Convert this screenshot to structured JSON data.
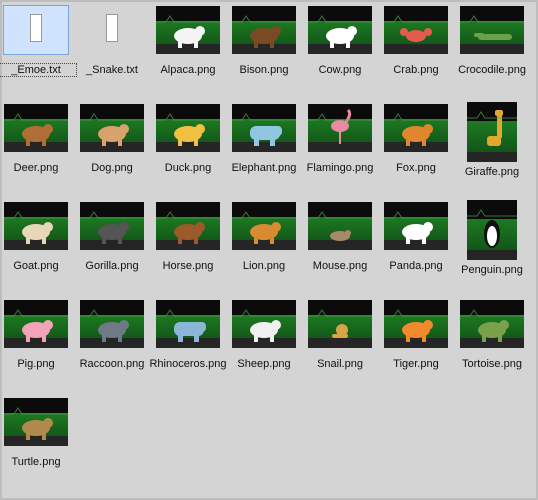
{
  "files": [
    {
      "name": "_Emoe.txt",
      "kind": "txt",
      "selected": true,
      "animal": "doc-icon"
    },
    {
      "name": "_Snake.txt",
      "kind": "txt",
      "selected": false,
      "animal": "doc-icon"
    },
    {
      "name": "Alpaca.png",
      "kind": "png",
      "animal": "alpaca",
      "color": "#f4f4f4"
    },
    {
      "name": "Bison.png",
      "kind": "png",
      "animal": "bison",
      "color": "#7a4a25"
    },
    {
      "name": "Cow.png",
      "kind": "png",
      "animal": "cow",
      "color": "#ffffff"
    },
    {
      "name": "Crab.png",
      "kind": "png",
      "animal": "crab",
      "color": "#e35b4e"
    },
    {
      "name": "Crocodile.png",
      "kind": "png",
      "animal": "crocodile",
      "color": "#6aa14a"
    },
    {
      "name": "Deer.png",
      "kind": "png",
      "animal": "deer",
      "color": "#b06f37"
    },
    {
      "name": "Dog.png",
      "kind": "png",
      "animal": "dog",
      "color": "#d7a26b"
    },
    {
      "name": "Duck.png",
      "kind": "png",
      "animal": "duck",
      "color": "#f0c040"
    },
    {
      "name": "Elephant.png",
      "kind": "png",
      "animal": "elephant",
      "color": "#90c7e0"
    },
    {
      "name": "Flamingo.png",
      "kind": "png",
      "animal": "flamingo",
      "color": "#e78aa2"
    },
    {
      "name": "Fox.png",
      "kind": "png",
      "animal": "fox",
      "color": "#e0862d"
    },
    {
      "name": "Giraffe.png",
      "kind": "png",
      "animal": "giraffe",
      "color": "#e2a82d",
      "tall": true
    },
    {
      "name": "Goat.png",
      "kind": "png",
      "animal": "goat",
      "color": "#e8d6b8"
    },
    {
      "name": "Gorilla.png",
      "kind": "png",
      "animal": "gorilla",
      "color": "#555555"
    },
    {
      "name": "Horse.png",
      "kind": "png",
      "animal": "horse",
      "color": "#9a5a2a"
    },
    {
      "name": "Lion.png",
      "kind": "png",
      "animal": "lion",
      "color": "#d78c34"
    },
    {
      "name": "Mouse.png",
      "kind": "png",
      "animal": "mouse",
      "color": "#a88a6a"
    },
    {
      "name": "Panda.png",
      "kind": "png",
      "animal": "panda",
      "color": "#ffffff"
    },
    {
      "name": "Penguin.png",
      "kind": "png",
      "animal": "penguin",
      "color": "#222222",
      "tall": true
    },
    {
      "name": "Pig.png",
      "kind": "png",
      "animal": "pig",
      "color": "#f3a3b8"
    },
    {
      "name": "Raccoon.png",
      "kind": "png",
      "animal": "raccoon",
      "color": "#6f7a86"
    },
    {
      "name": "Rhinoceros.png",
      "kind": "png",
      "animal": "rhinoceros",
      "color": "#8cb6d6"
    },
    {
      "name": "Sheep.png",
      "kind": "png",
      "animal": "sheep",
      "color": "#f0f0f0"
    },
    {
      "name": "Snail.png",
      "kind": "png",
      "animal": "snail",
      "color": "#d9a34a"
    },
    {
      "name": "Tiger.png",
      "kind": "png",
      "animal": "tiger",
      "color": "#f08a2a"
    },
    {
      "name": "Tortoise.png",
      "kind": "png",
      "animal": "tortoise",
      "color": "#7aa14a"
    },
    {
      "name": "Turtle.png",
      "kind": "png",
      "animal": "turtle",
      "color": "#b08a4a"
    }
  ]
}
